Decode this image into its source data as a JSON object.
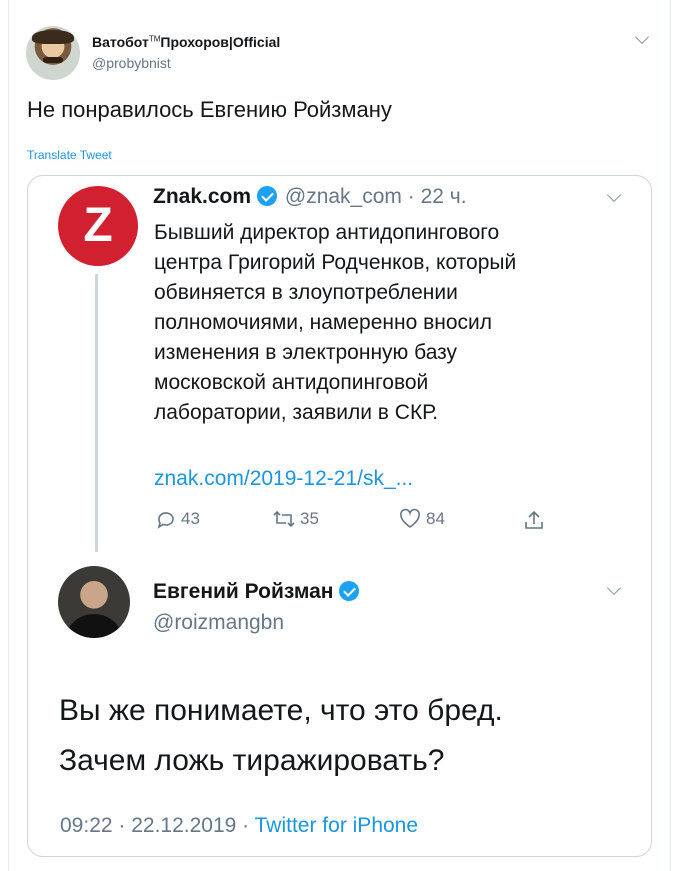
{
  "outer_tweet": {
    "author_name": "Ватобот",
    "author_name_tm": "TM",
    "author_name_rest": "Прохоров|Official",
    "handle": "@probybnist",
    "text": "Не понравилось Евгению Ройзману",
    "translate_label": "Translate Tweet"
  },
  "quoted_tweet_1": {
    "avatar_letter": "Z",
    "author_name": "Znak.com",
    "handle": "@znak_com",
    "time": "· 22 ч.",
    "text_lines": [
      "Бывший директор антидопингового",
      "центра Григорий Родченков, который",
      "обвиняется в злоупотреблении",
      "полномочиями, намеренно вносил",
      "изменения в электронную базу",
      "московской антидопинговой",
      "лаборатории, заявили в СКР."
    ],
    "link": "znak.com/2019-12-21/sk_...",
    "replies": "43",
    "retweets": "35",
    "likes": "84"
  },
  "quoted_tweet_2": {
    "author_name": "Евгений Ройзман",
    "handle": "@roizmangbn",
    "text_lines": [
      "Вы же понимаете, что это бред.",
      "Зачем ложь тиражировать?"
    ],
    "timestamp": "09:22 · 22.12.2019 ·",
    "source": "Twitter for iPhone"
  },
  "colors": {
    "link_blue": "#1b95e0",
    "verified_blue": "#1da1f2",
    "znak_red": "#d1202f",
    "muted_gray": "#657786",
    "border": "#ccd6dd"
  }
}
